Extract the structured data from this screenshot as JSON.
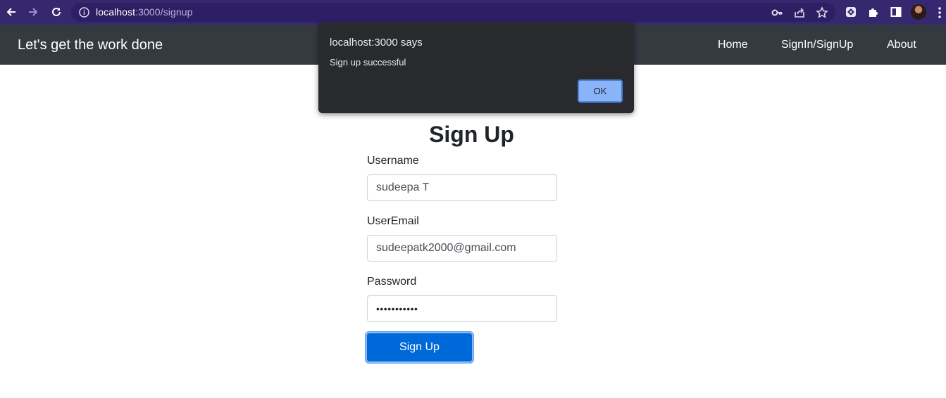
{
  "browser": {
    "url_host": "localhost",
    "url_path": ":3000/signup",
    "icons": [
      "back-arrow-icon",
      "forward-arrow-icon",
      "reload-icon",
      "info-icon",
      "key-icon",
      "share-icon",
      "star-icon",
      "extension-app-icon",
      "puzzle-icon",
      "side-panel-icon",
      "profile-avatar",
      "kebab-menu-icon"
    ]
  },
  "navbar": {
    "brand": "Let's get the work done",
    "links": [
      "Home",
      "SignIn/SignUp",
      "About"
    ],
    "background": "#343a40"
  },
  "form": {
    "title": "Sign Up",
    "username_label": "Username",
    "username_value": "sudeepa T",
    "email_label": "UserEmail",
    "email_value": "sudeepatk2000@gmail.com",
    "password_label": "Password",
    "password_value": "•••••••••••",
    "submit_label": "Sign Up",
    "accent": "#0069d9"
  },
  "dialog": {
    "title": "localhost:3000 says",
    "message": "Sign up successful",
    "ok_label": "OK",
    "accent": "#8ab4f8"
  }
}
